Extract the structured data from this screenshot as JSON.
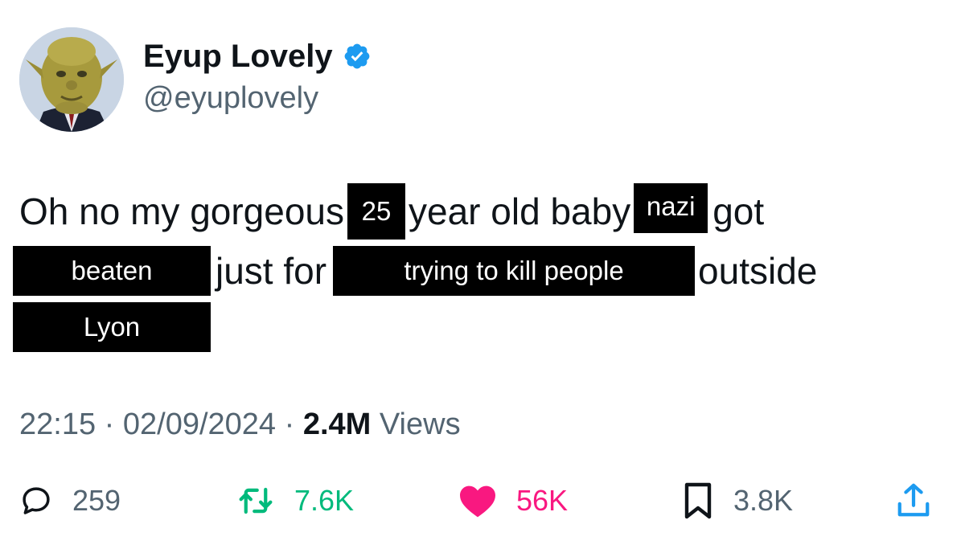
{
  "author": {
    "display_name": "Eyup Lovely",
    "handle": "@eyuplovely",
    "verified": true,
    "avatar_icon": "avatar-portrait",
    "verified_icon": "verified-badge-icon"
  },
  "tweet": {
    "segments": {
      "t1": "Oh no my gorgeous",
      "r1": "25",
      "t2": "year old baby",
      "r2": "nazi",
      "t3": "got",
      "r3": "beaten",
      "t4": "just for",
      "r4": "trying to kill people",
      "t5": "outside",
      "r5": "Lyon"
    }
  },
  "meta": {
    "time": "22:15",
    "separator": "·",
    "date": "02/09/2024",
    "views_count": "2.4M",
    "views_label": "Views"
  },
  "actions": {
    "replies": "259",
    "reposts": "7.6K",
    "likes": "56K",
    "bookmarks": "3.8K"
  },
  "colors": {
    "text": "#0f1419",
    "secondary": "#536471",
    "verified": "#1d9bf0",
    "repost": "#00ba7c",
    "like": "#f91880",
    "redaction": "#000000"
  }
}
